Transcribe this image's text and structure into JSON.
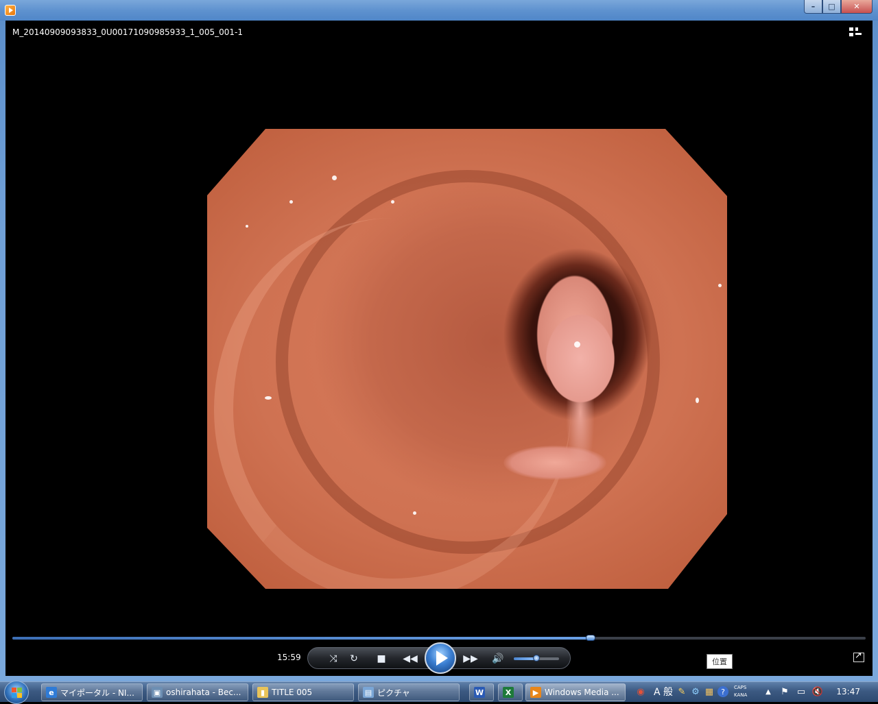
{
  "window": {
    "app_icon": "media-player-icon",
    "caption_buttons": {
      "minimize": "–",
      "maximize": "□",
      "close": "✕"
    }
  },
  "player": {
    "media_title": "M_20140909093833_0U00171090985933_1_005_001-1",
    "elapsed_time": "15:59",
    "seek_progress": 0.678,
    "volume_level": 0.5,
    "tooltip": "位置",
    "controls": {
      "shuffle_icon": "shuffle-icon",
      "repeat_icon": "repeat-icon",
      "stop_icon": "stop-icon",
      "previous_icon": "previous-icon",
      "play_icon": "play-icon",
      "next_icon": "next-icon",
      "mute_icon": "speaker-icon"
    }
  },
  "taskbar": {
    "buttons": [
      {
        "label": "マイポータル - NI...",
        "icon": "ie-icon",
        "color": "#2f7bd6",
        "glyph": "e"
      },
      {
        "label": "oshirahata - Bec...",
        "icon": "app-icon",
        "color": "#6d8fb3",
        "glyph": "▣"
      },
      {
        "label": "TITLE 005",
        "icon": "folder-icon",
        "color": "#e8c35a",
        "glyph": "▮"
      },
      {
        "label": "ピクチャ",
        "icon": "pictures-icon",
        "color": "#7aa6d6",
        "glyph": "▤"
      },
      {
        "label": "",
        "icon": "word-icon",
        "color": "#2b5bb5",
        "glyph": "W"
      },
      {
        "label": "",
        "icon": "excel-icon",
        "color": "#1e7a3a",
        "glyph": "X"
      },
      {
        "label": "Windows Media ...",
        "icon": "media-player-icon",
        "color": "#e8861a",
        "glyph": "▶"
      }
    ],
    "ime_label": "A 般",
    "caps_text": "CAPS",
    "kana_text": "KANA",
    "clock": "13:47"
  }
}
